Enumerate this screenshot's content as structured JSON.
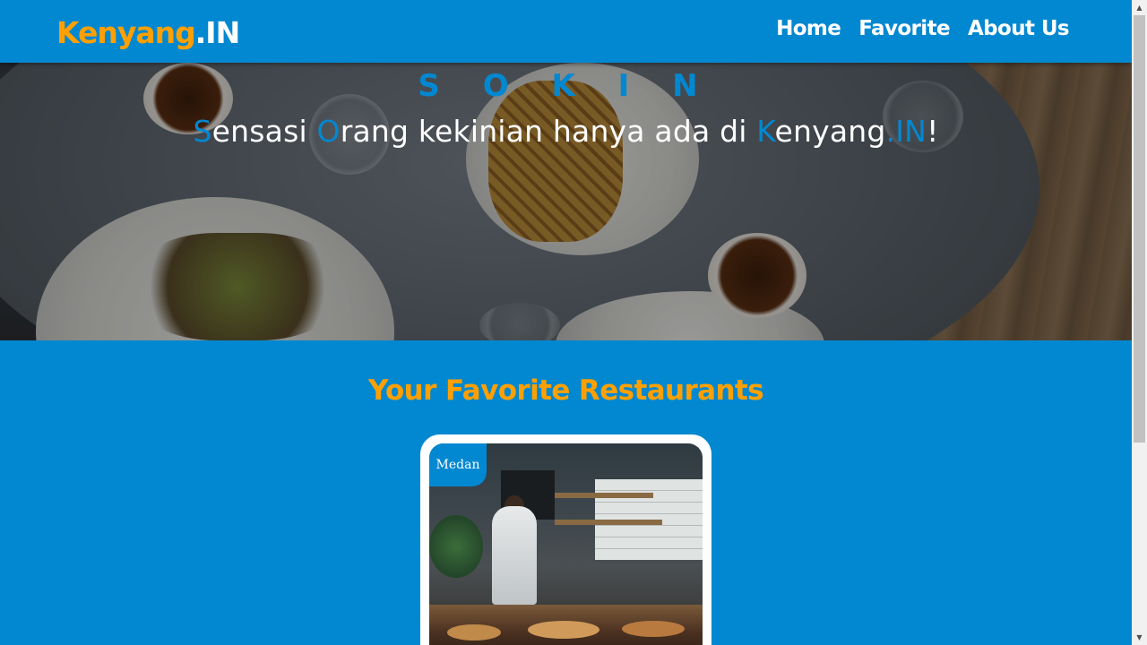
{
  "header": {
    "logo_part1": "Kenyang",
    "logo_part2": ".IN",
    "nav": [
      {
        "label": "Home"
      },
      {
        "label": "Favorite"
      },
      {
        "label": "About Us"
      }
    ]
  },
  "hero": {
    "title": "S O K I N",
    "subtitle": {
      "s1": "S",
      "t1": "ensasi ",
      "s2": "O",
      "t2": "rang kekinian hanya ada di ",
      "s3": "K",
      "t3": "enyang",
      "s4": ".IN",
      "t4": "!"
    }
  },
  "section": {
    "title": "Your Favorite Restaurants"
  },
  "restaurants": [
    {
      "city": "Medan"
    }
  ],
  "colors": {
    "primary": "#0288d1",
    "accent": "#ffa000",
    "white": "#ffffff"
  }
}
